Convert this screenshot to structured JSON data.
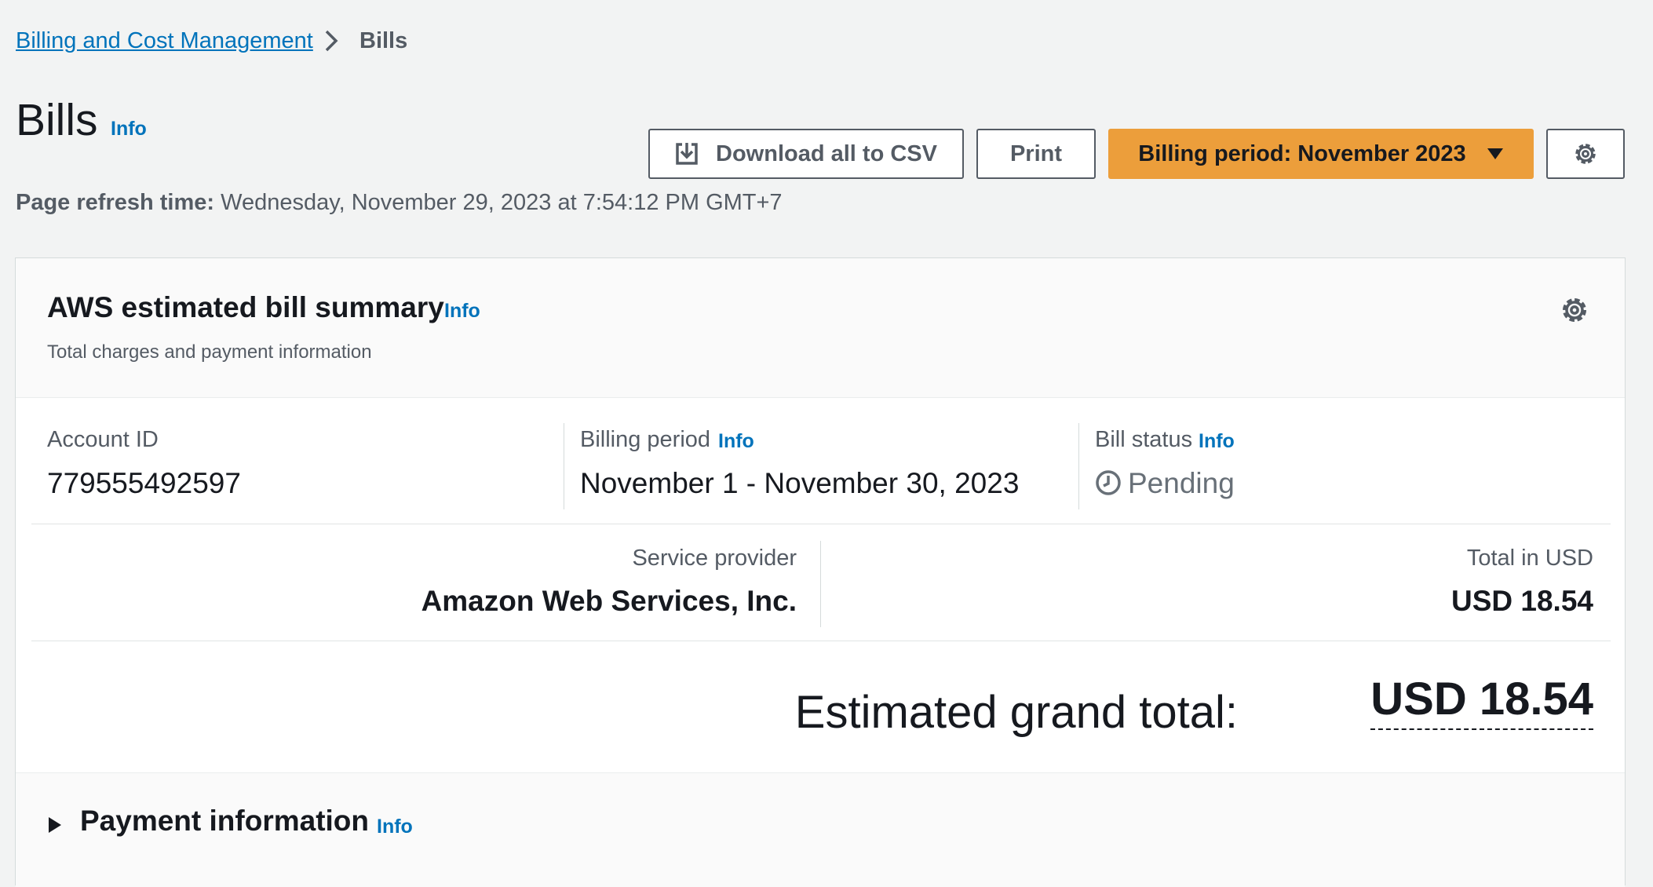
{
  "breadcrumb": {
    "parent": "Billing and Cost Management",
    "current": "Bills"
  },
  "header": {
    "title": "Bills",
    "info": "Info",
    "download_label": "Download all to CSV",
    "print_label": "Print",
    "billing_period_label": "Billing period: November 2023",
    "refresh_label": "Page refresh time:",
    "refresh_value": "Wednesday, November 29, 2023 at 7:54:12 PM GMT+7"
  },
  "summary": {
    "title": "AWS estimated bill summary",
    "info": "Info",
    "subtitle": "Total charges and payment information",
    "account_id_label": "Account ID",
    "account_id": "779555492597",
    "billing_period_label": "Billing period",
    "billing_period_info": "Info",
    "billing_period": "November 1 - November 30, 2023",
    "bill_status_label": "Bill status",
    "bill_status_info": "Info",
    "bill_status": "Pending",
    "service_provider_label": "Service provider",
    "service_provider": "Amazon Web Services, Inc.",
    "total_label": "Total in USD",
    "total_value": "USD 18.54",
    "grand_total_label": "Estimated grand total:",
    "grand_total_value": "USD 18.54"
  },
  "payment": {
    "title": "Payment information",
    "info": "Info"
  },
  "colors": {
    "accent_orange": "#ec9e3b",
    "link_blue": "#0073bb"
  }
}
